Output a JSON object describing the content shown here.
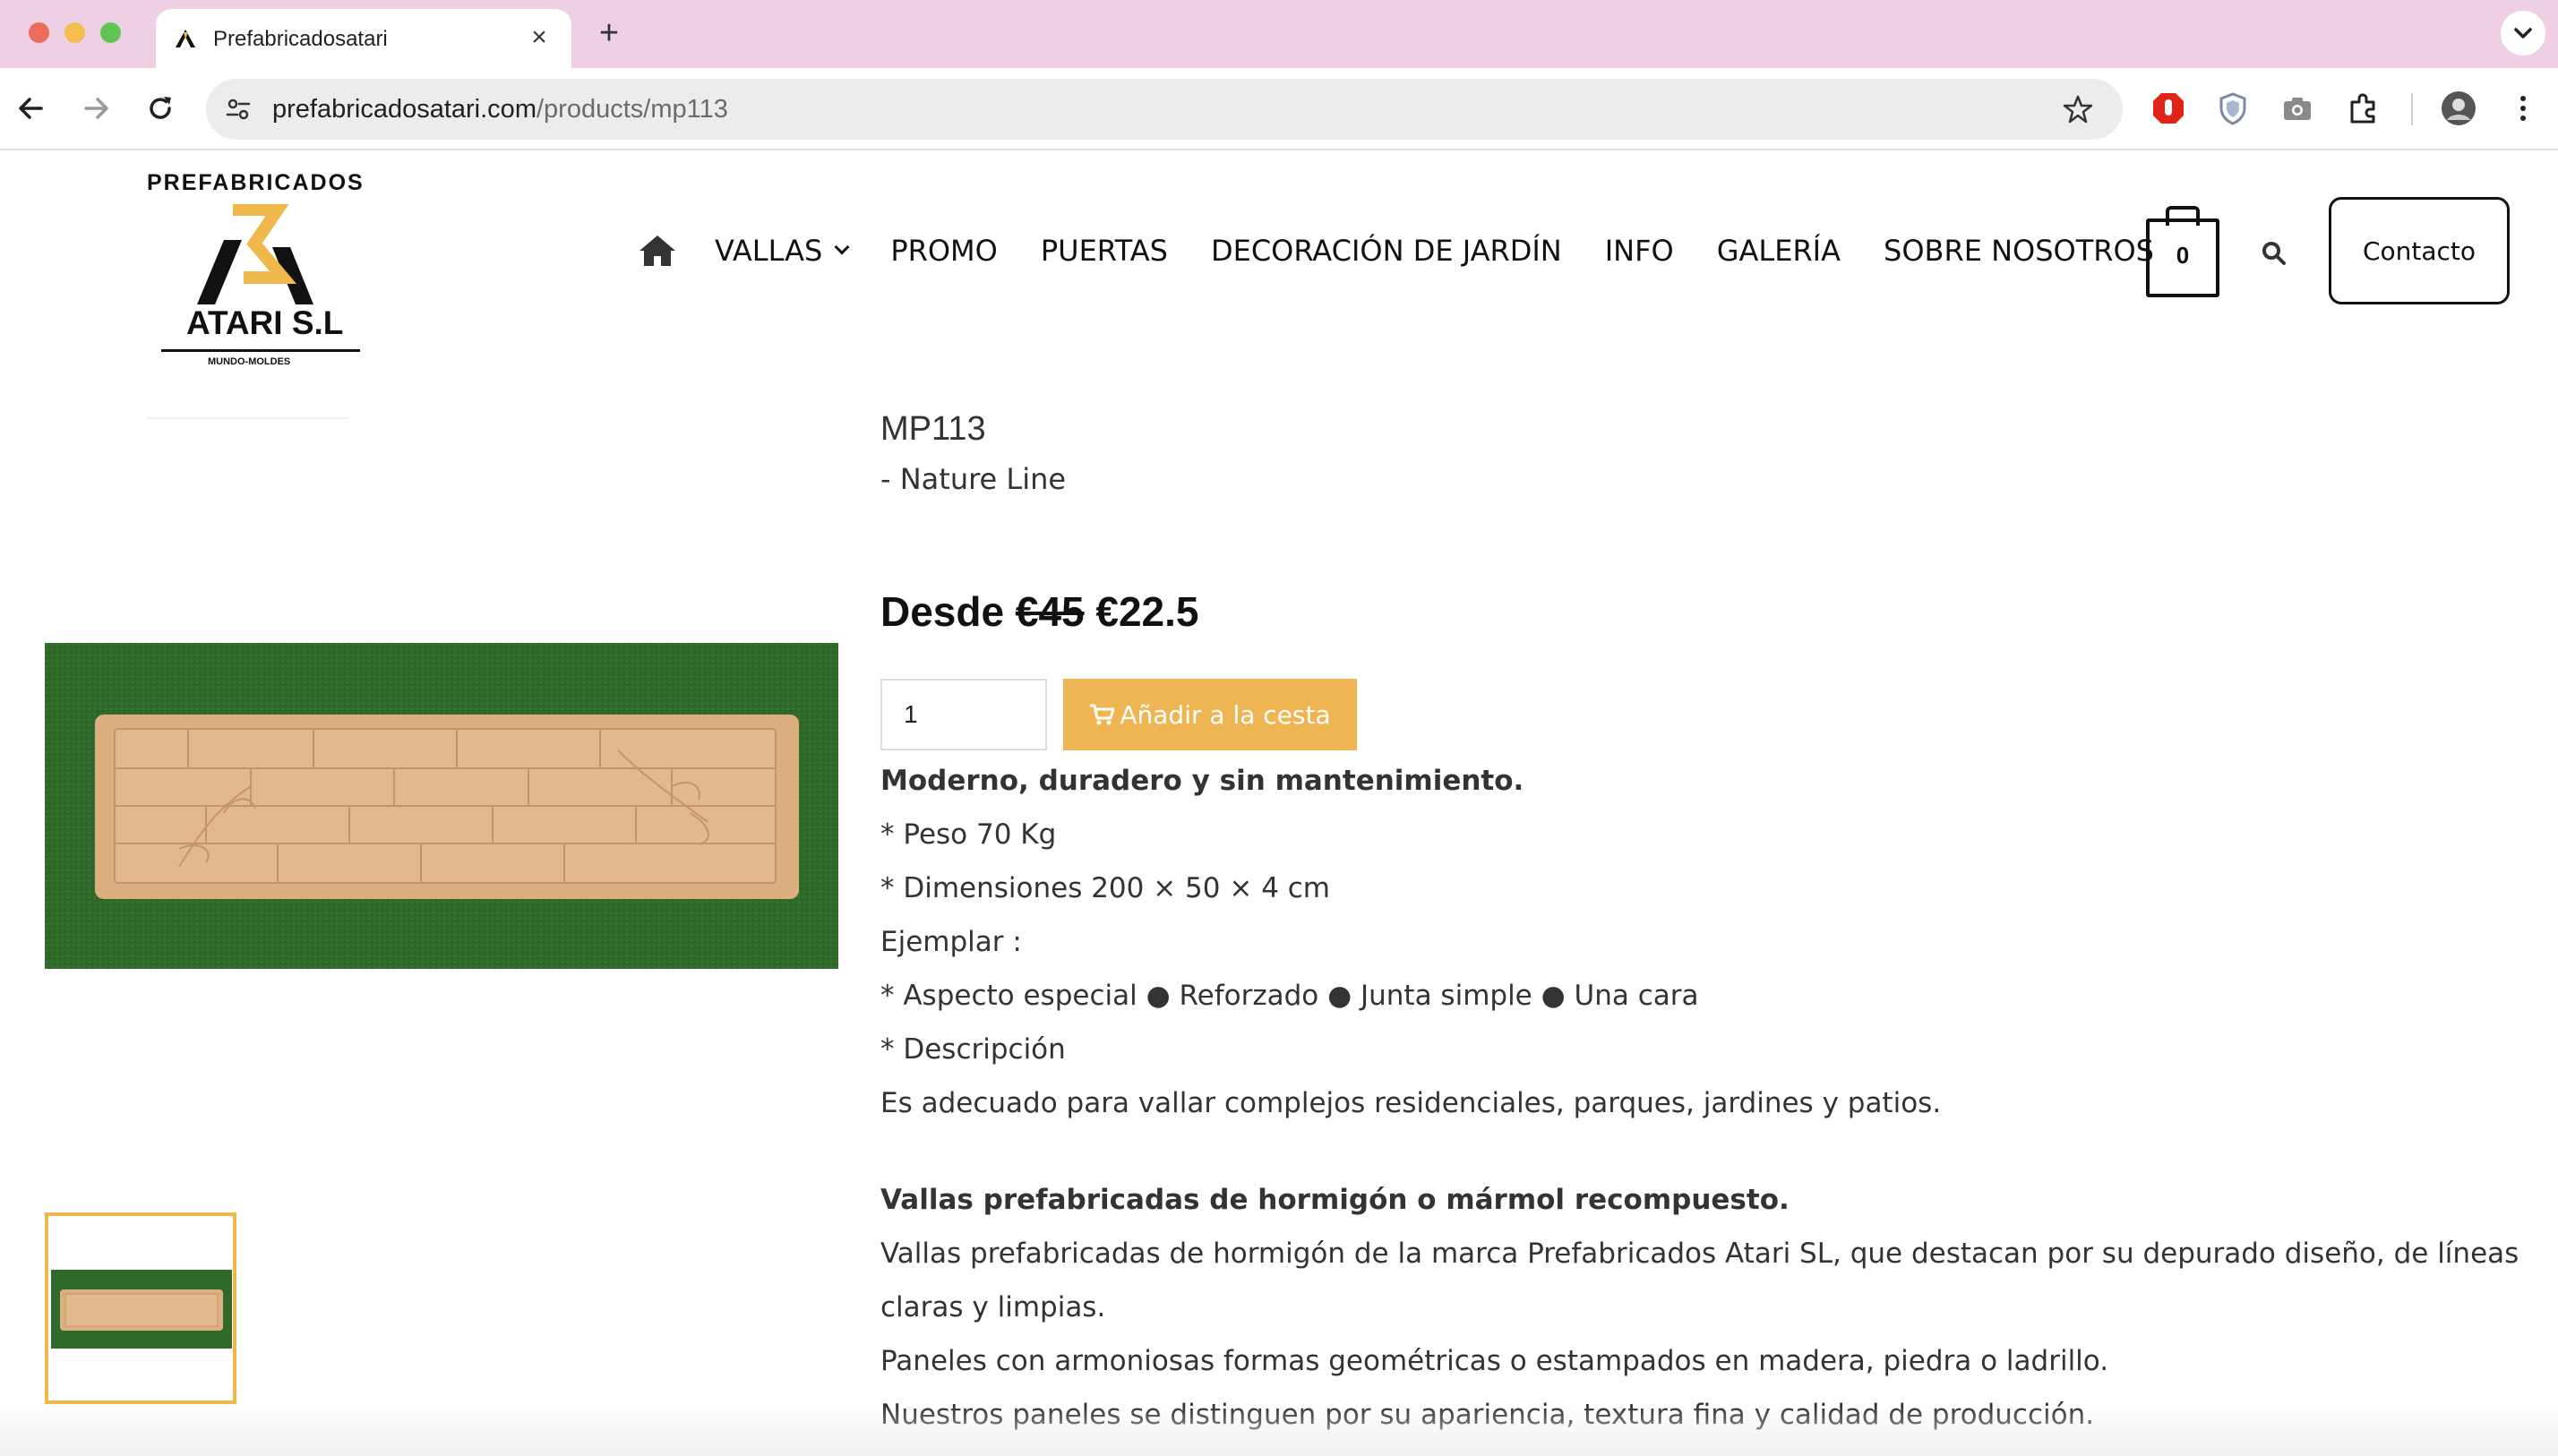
{
  "browser": {
    "tab_title": "Prefabricadosatari",
    "url_domain": "prefabricadosatari.com",
    "url_path": "/products/mp113"
  },
  "logo": {
    "top": "PREFABRICADOS",
    "name": "ATARI S.L",
    "sub": "MUNDO-MOLDES"
  },
  "nav": {
    "items": [
      {
        "label": "VALLAS"
      },
      {
        "label": "PROMO"
      },
      {
        "label": "PUERTAS"
      },
      {
        "label": "DECORACIÓN DE JARDÍN"
      },
      {
        "label": "INFO"
      },
      {
        "label": "GALERÍA"
      },
      {
        "label": "SOBRE NOSOTROS"
      }
    ],
    "cart_count": "0",
    "contact": "Contacto"
  },
  "product": {
    "title": "MP113",
    "subtitle": "- Nature Line",
    "price_prefix": "Desde",
    "price_old": "€45",
    "price_new": "€22.5",
    "quantity": "1",
    "add_to_cart": "Añadir a la cesta",
    "description": [
      "Moderno, duradero y sin mantenimiento.",
      "* Peso 70 Kg",
      "* Dimensiones 200 × 50 × 4 cm",
      "Ejemplar :",
      "* Aspecto especial ● Reforzado ● Junta simple ● Una cara",
      "* Descripción",
      "Es adecuado para vallar complejos residenciales, parques, jardines y patios.",
      "Vallas prefabricadas de hormigón o mármol recompuesto.",
      "Vallas prefabricadas de hormigón de la marca Prefabricados Atari SL, que destacan por su depurado diseño, de líneas",
      "claras y limpias.",
      "Paneles con armoniosas formas geométricas o estampados en madera, piedra o ladrillo.",
      "Nuestros paneles se distinguen por su apariencia, textura fina y calidad de producción."
    ]
  },
  "colors": {
    "tabbar": "#efcfe4",
    "accent": "#efb552",
    "brand_gold": "#f0b74a",
    "grass": "#2f6a2b"
  }
}
